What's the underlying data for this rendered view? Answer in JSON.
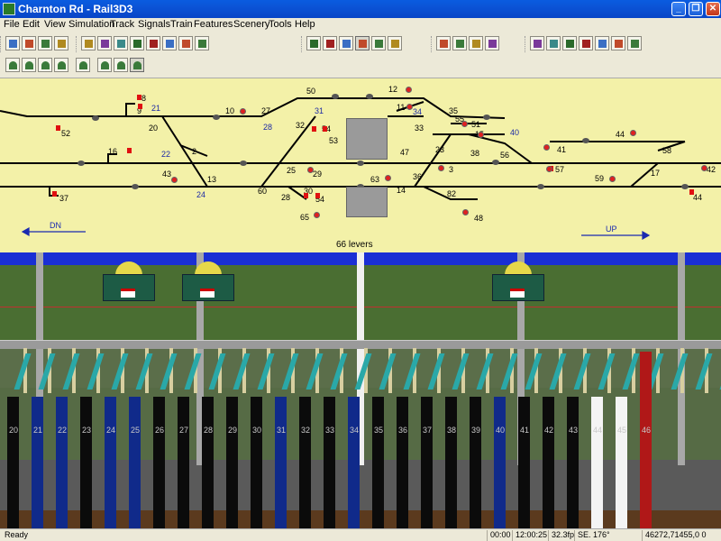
{
  "window": {
    "title": "Charnton Rd - Rail3D3"
  },
  "menu": [
    "File",
    "Edit",
    "View",
    "Simulation",
    "Track",
    "Signals",
    "Train",
    "Features",
    "Scenery",
    "Tools",
    "Help"
  ],
  "toolbar": {
    "row1_groups": [
      [
        "new-icon",
        "open-icon",
        "save-icon",
        "properties-icon"
      ],
      [
        "track-icon",
        "signal-icon",
        "scenery-icon",
        "route-icon",
        "train-icon",
        "station-icon",
        "tree-icon",
        "delete-icon"
      ],
      [
        "pause-icon",
        "play-icon",
        "step-icon",
        "speed1-icon",
        "speed2-icon",
        "speed3-icon"
      ],
      [
        "map1-icon",
        "map2-icon",
        "map3-icon",
        "map4-icon"
      ],
      [
        "view1-icon",
        "view2-icon",
        "view3-icon",
        "view4-icon",
        "view5-icon",
        "view6-icon",
        "view7-icon"
      ]
    ],
    "row2_icons": [
      "terrain-icon",
      "paint-icon",
      "hill-icon",
      "lake-icon",
      "tunnel-icon",
      "cutting-icon",
      "embank-icon",
      "mountain-icon"
    ]
  },
  "diagram": {
    "levers_label": "66 levers",
    "direction_down": "DN",
    "direction_up": "UP",
    "labels_black": [
      "8",
      "9",
      "50",
      "12",
      "10",
      "27",
      "11",
      "35",
      "52",
      "20",
      "32",
      "54",
      "33",
      "51",
      "53",
      "15",
      "44",
      "16",
      "2",
      "23",
      "38",
      "56",
      "41",
      "58",
      "43",
      "13",
      "25",
      "29",
      "47",
      "3",
      "57",
      "59",
      "17",
      "42",
      "60",
      "28",
      "30",
      "54",
      "63",
      "14",
      "36",
      "37",
      "82",
      "44",
      "65",
      "48",
      "55"
    ],
    "labels_blue": [
      "21",
      "31",
      "34",
      "28",
      "40",
      "22",
      "24"
    ]
  },
  "levers": {
    "numbers": [
      "20",
      "21",
      "22",
      "23",
      "24",
      "25",
      "26",
      "27",
      "28",
      "29",
      "30",
      "31",
      "32",
      "33",
      "34",
      "35",
      "36",
      "37",
      "38",
      "39",
      "40",
      "41",
      "42",
      "43",
      "44",
      "45",
      "46"
    ],
    "colors": {
      "black": "#0b0b0b",
      "blue": "#102a8a",
      "white": "#f4f4f4",
      "red": "#b01818"
    }
  },
  "status": {
    "ready": "Ready",
    "elapsed": "00:00",
    "clock": "12:00:25",
    "fps": "32.3fp",
    "heading": "SE. 176°",
    "coords": "46272,71455,0 0"
  }
}
